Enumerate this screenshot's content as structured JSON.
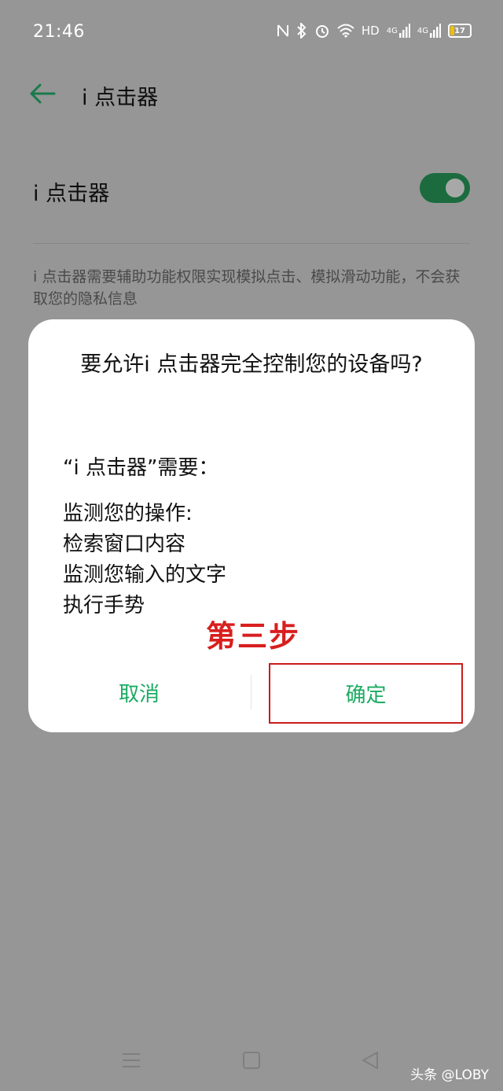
{
  "status_bar": {
    "time": "21:46",
    "hd_label": "HD",
    "net1_label": "4G",
    "net2_label": "4G",
    "battery_level": "17"
  },
  "app_bar": {
    "title": "i 点击器"
  },
  "setting": {
    "label": "i 点击器",
    "enabled": true,
    "description": "i 点击器需要辅助功能权限实现模拟点击、模拟滑动功能，不会获取您的隐私信息"
  },
  "dialog": {
    "title": "要允许i 点击器完全控制您的设备吗?",
    "subhead": "“i 点击器”需要：",
    "permissions": [
      "监测您的操作:",
      "检索窗口内容",
      "监测您输入的文字",
      "执行手势"
    ],
    "annotation": "第三步",
    "cancel_label": "取消",
    "ok_label": "确定"
  },
  "watermark": "头条 @LOBY",
  "colors": {
    "accent": "#1bab62",
    "annotation_red": "#d81e1e",
    "toggle_on": "#1b6b3f"
  }
}
